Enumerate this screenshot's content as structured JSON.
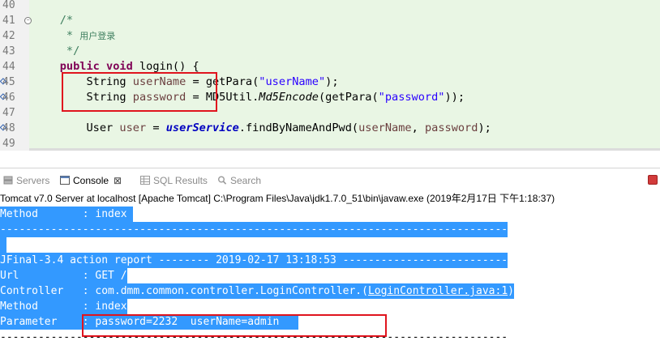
{
  "editor": {
    "lines": [
      {
        "num": "40",
        "text": ""
      },
      {
        "num": "41",
        "text": "    /*"
      },
      {
        "num": "42",
        "prefix": "     * ",
        "cjk": "用户登录"
      },
      {
        "num": "43",
        "text": "     */"
      },
      {
        "num": "44",
        "kw1": "public",
        "kw2": "void",
        "rest": " login() {"
      },
      {
        "num": "45",
        "type": "String",
        "var": "userName",
        "mid": " = getPara(",
        "str": "\"userName\"",
        "end": ");"
      },
      {
        "num": "46",
        "type": "String",
        "var": "password",
        "mid": " = MD5Util.",
        "method": "Md5Encode",
        "mid2": "(getPara(",
        "str": "\"password\"",
        "end": "));"
      },
      {
        "num": "47",
        "text": ""
      },
      {
        "num": "48",
        "type": "User",
        "var": "user",
        "mid": " = ",
        "field": "userService",
        "call": ".findByNameAndPwd(",
        "a1": "userName",
        "sep": ", ",
        "a2": "password",
        "end": ");"
      },
      {
        "num": "49",
        "text": ""
      }
    ]
  },
  "tabs": [
    {
      "label": "Servers",
      "icon": "servers-icon"
    },
    {
      "label": "Console",
      "icon": "console-icon",
      "close": "⊠"
    },
    {
      "label": "SQL Results",
      "icon": "sql-results-icon"
    },
    {
      "label": "Search",
      "icon": "search-icon"
    }
  ],
  "launch_info": "Tomcat v7.0 Server at localhost [Apache Tomcat] C:\\Program Files\\Java\\jdk1.7.0_51\\bin\\javaw.exe (2019年2月17日 下午1:18:37)",
  "console": {
    "lines": [
      "Method       : index ",
      "--------------------------------------------------------------------------------",
      "",
      "JFinal-3.4 action report -------- 2019-02-17 13:18:53 --------------------------",
      "Url          : GET /",
      "Method       : index",
      "Parameter    : password=2232  userName=admin   ",
      "--------------------------------------------------------------------------------"
    ],
    "controller_prefix": "Controller   : com.dmm.common.controller.LoginController.(",
    "controller_link": "LoginController.java:1",
    "controller_suffix": ")"
  },
  "colors": {
    "selection": "#3399ff",
    "annotation": "#e0141e",
    "editor_bg": "#e9f6e4",
    "keyword": "#7f0055",
    "string": "#2a00ff",
    "comment": "#3f7f5f"
  }
}
